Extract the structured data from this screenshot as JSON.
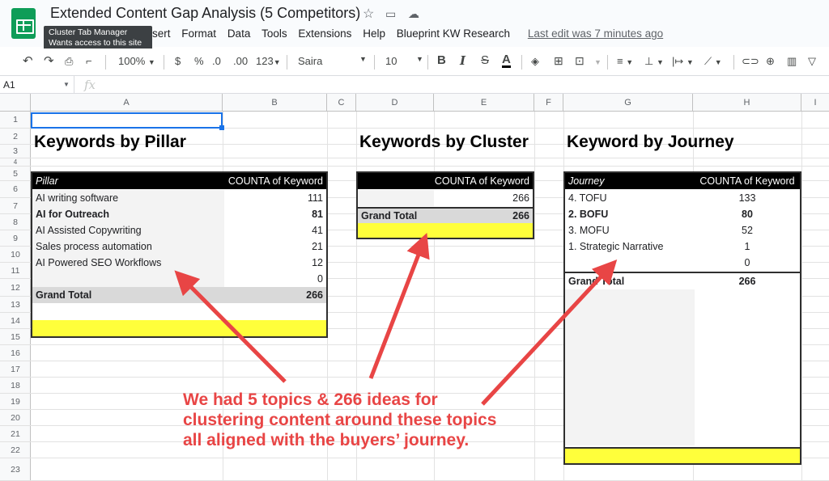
{
  "title_bar": {
    "doc_title": "Extended Content Gap Analysis (5 Competitors)",
    "tooltip_line1": "Cluster Tab Manager",
    "tooltip_line2": "Wants access to this site",
    "menu": [
      "sert",
      "Format",
      "Data",
      "Tools",
      "Extensions",
      "Help",
      "Blueprint KW Research"
    ],
    "last_edit": "Last edit was 7 minutes ago"
  },
  "toolbar": {
    "zoom": "100%",
    "currency": "$",
    "percent": "%",
    "dec_decrease": ".0",
    "dec_increase": ".00",
    "format": "123",
    "font": "Saira",
    "font_size": "10",
    "bold": "B",
    "italic": "I",
    "strike": "S",
    "text_color": "A",
    "text_color_hex": "#000000"
  },
  "formula_bar": {
    "cell_ref": "A1",
    "fx": "fx"
  },
  "columns": [
    "A",
    "B",
    "C",
    "D",
    "E",
    "F",
    "G",
    "H",
    "I"
  ],
  "rows": [
    "1",
    "2",
    "3",
    "4",
    "5",
    "6",
    "7",
    "8",
    "9",
    "10",
    "11",
    "12",
    "13",
    "14",
    "15",
    "16",
    "17",
    "18",
    "19",
    "20",
    "21",
    "22",
    "23"
  ],
  "pillar": {
    "heading": "Keywords by Pillar",
    "col1": "Pillar",
    "col2": "COUNTA of Keyword",
    "rows": [
      {
        "label": "AI writing software",
        "value": "111"
      },
      {
        "label": "AI for Outreach",
        "value": "81"
      },
      {
        "label": "AI Assisted Copywriting",
        "value": "41"
      },
      {
        "label": "Sales process automation",
        "value": "21"
      },
      {
        "label": "AI Powered SEO Workflows",
        "value": "12"
      },
      {
        "label": "",
        "value": "0"
      }
    ],
    "total_label": "Grand Total",
    "total_value": "266"
  },
  "cluster": {
    "heading": "Keywords by Cluster",
    "col2": "COUNTA of Keyword",
    "row_value": "266",
    "total_label": "Grand Total",
    "total_value": "266"
  },
  "journey": {
    "heading": "Keyword by Journey",
    "col1": "Journey",
    "col2": "COUNTA of Keyword",
    "rows": [
      {
        "label": "4. TOFU",
        "value": "133"
      },
      {
        "label": "2. BOFU",
        "value": "80"
      },
      {
        "label": "3. MOFU",
        "value": "52"
      },
      {
        "label": "1. Strategic Narrative",
        "value": "1"
      },
      {
        "label": "",
        "value": "0"
      }
    ],
    "total_label": "Grand Total",
    "total_value": "266"
  },
  "annotation": {
    "line1": "We had 5 topics & 266 ideas for",
    "line2": "clustering content around these topics",
    "line3": "all aligned with the buyers’ journey.",
    "color": "#e84545"
  },
  "colors": {
    "highlight": "#ffff3b",
    "header_bg": "#000000",
    "total_bg": "#d9d9d9",
    "selection": "#1a73e8"
  }
}
